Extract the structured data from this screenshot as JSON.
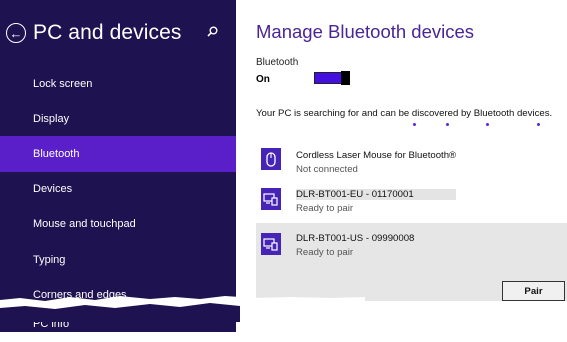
{
  "sidebar": {
    "title": "PC and devices",
    "back_icon": "back-arrow-icon",
    "search_icon": "search-icon",
    "items": [
      {
        "label": "Lock screen"
      },
      {
        "label": "Display"
      },
      {
        "label": "Bluetooth",
        "active": true
      },
      {
        "label": "Devices"
      },
      {
        "label": "Mouse and touchpad"
      },
      {
        "label": "Typing"
      },
      {
        "label": "Corners and edges"
      },
      {
        "label": "PC info"
      }
    ]
  },
  "main": {
    "title": "Manage Bluetooth devices",
    "bluetooth_label": "Bluetooth",
    "bluetooth_state": "On",
    "status_text": "Your PC is searching for and can be discovered by Bluetooth devices.",
    "devices": [
      {
        "name": "Cordless Laser Mouse for Bluetooth®",
        "status": "Not connected",
        "icon": "mouse-icon"
      },
      {
        "name": "DLR-BT001-EU - 01170001",
        "status": "Ready to pair",
        "icon": "device-pair-icon"
      },
      {
        "name": "DLR-BT001-US - 09990008",
        "status": "Ready to pair",
        "icon": "device-pair-icon",
        "selected": true
      }
    ],
    "pair_button": "Pair"
  },
  "colors": {
    "sidebar_bg": "#1f1250",
    "active_item": "#5a1fc9",
    "accent": "#4410e0",
    "title": "#4a2593"
  }
}
